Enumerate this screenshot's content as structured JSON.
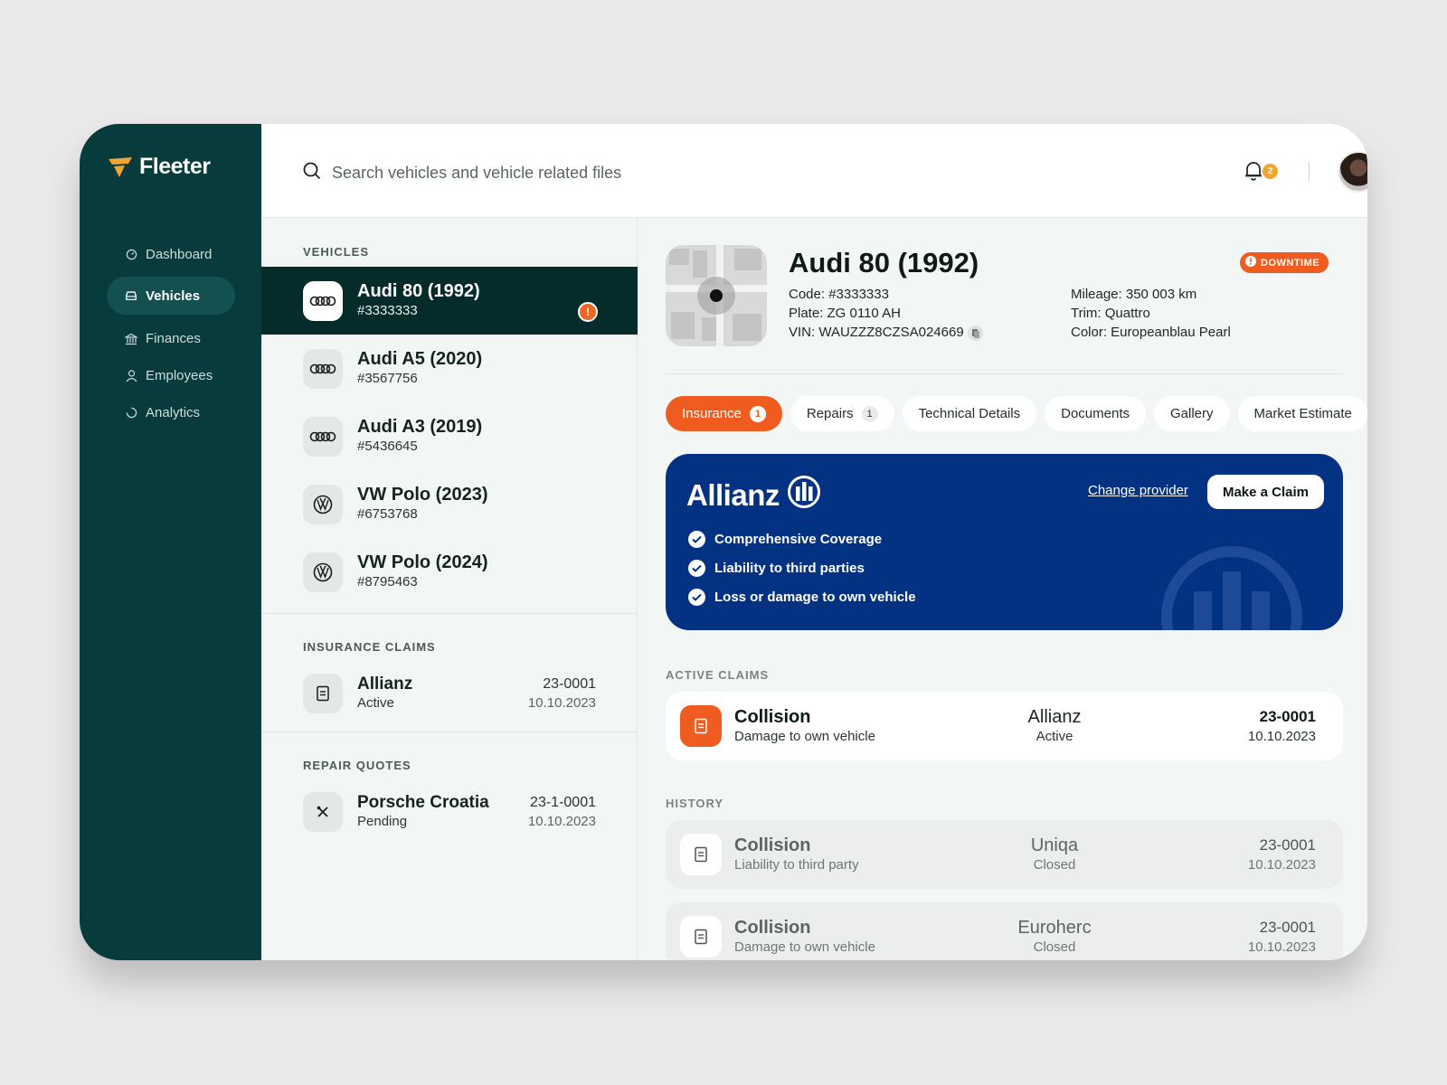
{
  "app": {
    "name": "Fleeter"
  },
  "sidebar": {
    "items": [
      {
        "label": "Dashboard",
        "icon": "gauge-icon"
      },
      {
        "label": "Vehicles",
        "icon": "car-icon",
        "active": true
      },
      {
        "label": "Finances",
        "icon": "bank-icon"
      },
      {
        "label": "Employees",
        "icon": "user-icon"
      },
      {
        "label": "Analytics",
        "icon": "chart-circle-icon"
      }
    ]
  },
  "topbar": {
    "search_placeholder": "Search vehicles and vehicle related files",
    "notifications_count": "2"
  },
  "list": {
    "vehicles_label": "VEHICLES",
    "vehicles": [
      {
        "name": "Audi 80 (1992)",
        "code": "#3333333",
        "brand": "audi",
        "alert": "!"
      },
      {
        "name": "Audi A5 (2020)",
        "code": "#3567756",
        "brand": "audi"
      },
      {
        "name": "Audi A3 (2019)",
        "code": "#5436645",
        "brand": "audi"
      },
      {
        "name": "VW Polo (2023)",
        "code": "#6753768",
        "brand": "vw"
      },
      {
        "name": "VW Polo (2024)",
        "code": "#8795463",
        "brand": "vw"
      }
    ],
    "claims_label": "INSURANCE CLAIMS",
    "claim": {
      "title": "Allianz",
      "status": "Active",
      "number": "23-0001",
      "date": "10.10.2023"
    },
    "quotes_label": "REPAIR QUOTES",
    "quote": {
      "title": "Porsche Croatia",
      "status": "Pending",
      "number": "23-1-0001",
      "date": "10.10.2023"
    }
  },
  "detail": {
    "title": "Audi 80 (1992)",
    "status_badge": "DOWNTIME",
    "code": "Code: #3333333",
    "plate": "Plate: ZG 0110 AH",
    "vin": "VIN: WAUZZZ8CZSA024669",
    "mileage": "Mileage: 350 003 km",
    "trim": "Trim: Quattro",
    "color": "Color: Europeanblau Pearl",
    "tabs": [
      {
        "label": "Insurance",
        "count": "1",
        "active": true
      },
      {
        "label": "Repairs",
        "count": "1"
      },
      {
        "label": "Technical Details"
      },
      {
        "label": "Documents"
      },
      {
        "label": "Gallery"
      },
      {
        "label": "Market Estimate"
      }
    ],
    "insurance": {
      "provider": "Allianz",
      "change_link": "Change provider",
      "claim_button": "Make a Claim",
      "coverage": [
        "Comprehensive Coverage",
        "Liability to third parties",
        "Loss or damage to own vehicle"
      ]
    },
    "active_claims_label": "ACTIVE CLAIMS",
    "active_claims": [
      {
        "title": "Collision",
        "subtitle": "Damage to own vehicle",
        "provider": "Allianz",
        "status": "Active",
        "number": "23-0001",
        "date": "10.10.2023"
      }
    ],
    "history_label": "HISTORY",
    "history": [
      {
        "title": "Collision",
        "subtitle": "Liability to third party",
        "provider": "Uniqa",
        "status": "Closed",
        "number": "23-0001",
        "date": "10.10.2023"
      },
      {
        "title": "Collision",
        "subtitle": "Damage to own vehicle",
        "provider": "Euroherc",
        "status": "Closed",
        "number": "23-0001",
        "date": "10.10.2023"
      }
    ]
  },
  "colors": {
    "sidebar": "#073b3c",
    "accent": "#f05b1f",
    "allianz": "#043283",
    "logo": "#f2a533"
  }
}
